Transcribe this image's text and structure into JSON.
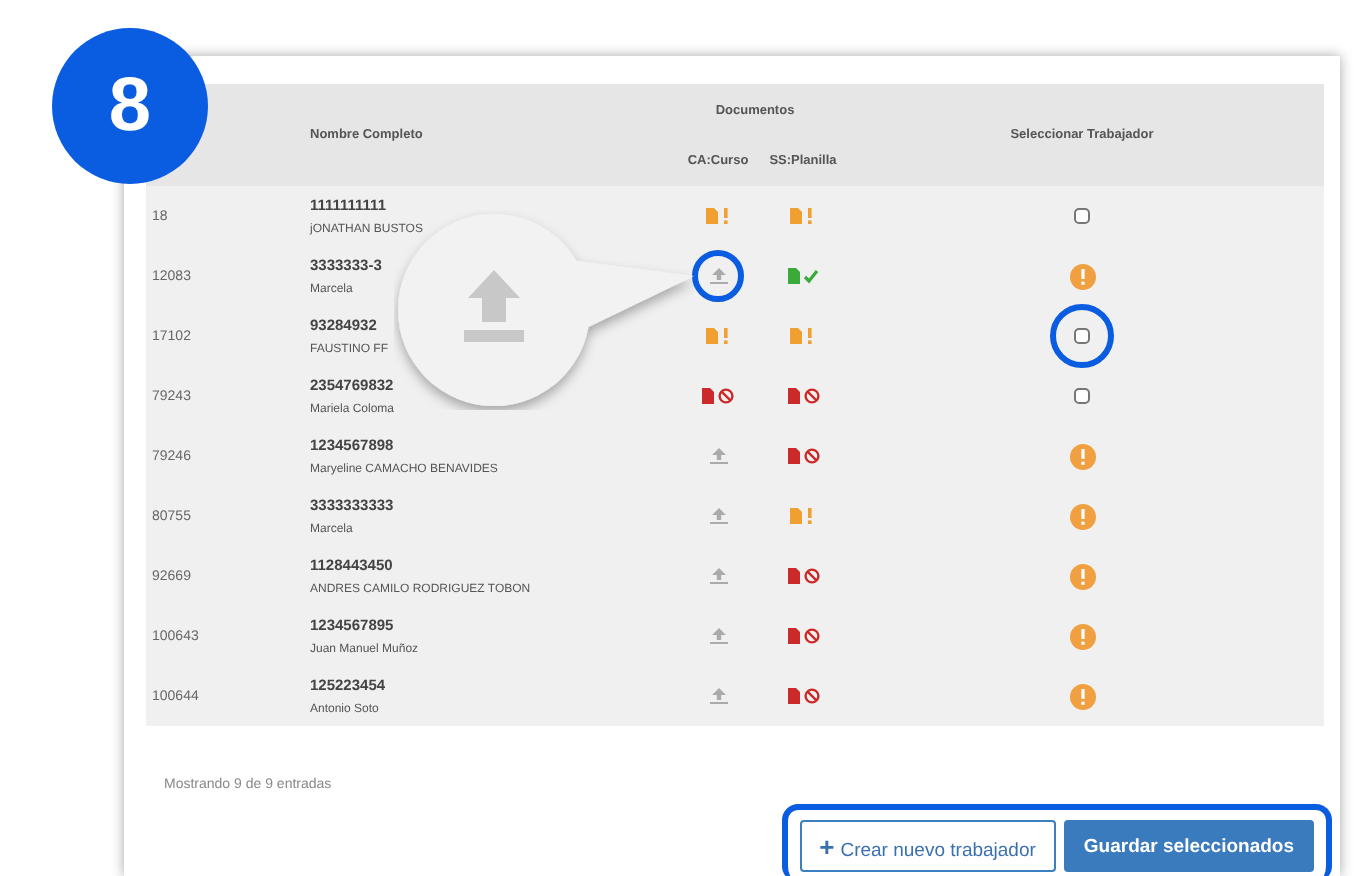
{
  "step_badge": "8",
  "table": {
    "columns": {
      "name": "Nombre Completo",
      "documents": "Documentos",
      "ca": "CA:Curso",
      "ss": "SS:Planilla",
      "select": "Seleccionar Trabajador"
    },
    "rows": [
      {
        "id": "18",
        "code": "1111111111",
        "name": "jONATHAN BUSTOS",
        "ca": {
          "kind": "pending"
        },
        "ss": {
          "kind": "pending"
        },
        "select": {
          "kind": "checkbox",
          "checked": false
        }
      },
      {
        "id": "12083",
        "code": "3333333-3",
        "name": "Marcela",
        "ca": {
          "kind": "upload",
          "highlighted": true,
          "callout": true
        },
        "ss": {
          "kind": "ok"
        },
        "select": {
          "kind": "warning"
        }
      },
      {
        "id": "17102",
        "code": "93284932",
        "name": "FAUSTINO FF",
        "ca": {
          "kind": "pending"
        },
        "ss": {
          "kind": "pending"
        },
        "select": {
          "kind": "checkbox",
          "checked": false,
          "highlighted": true
        }
      },
      {
        "id": "79243",
        "code": "2354769832",
        "name": "Mariela Coloma",
        "ca": {
          "kind": "rejected"
        },
        "ss": {
          "kind": "rejected"
        },
        "select": {
          "kind": "checkbox",
          "checked": false
        }
      },
      {
        "id": "79246",
        "code": "1234567898",
        "name": "Maryeline CAMACHO BENAVIDES",
        "ca": {
          "kind": "upload"
        },
        "ss": {
          "kind": "rejected"
        },
        "select": {
          "kind": "warning"
        }
      },
      {
        "id": "80755",
        "code": "3333333333",
        "name": "Marcela",
        "ca": {
          "kind": "upload"
        },
        "ss": {
          "kind": "pending"
        },
        "select": {
          "kind": "warning"
        }
      },
      {
        "id": "92669",
        "code": "1128443450",
        "name": "ANDRES CAMILO RODRIGUEZ TOBON",
        "ca": {
          "kind": "upload"
        },
        "ss": {
          "kind": "rejected"
        },
        "select": {
          "kind": "warning"
        }
      },
      {
        "id": "100643",
        "code": "1234567895",
        "name": "Juan Manuel Muñoz",
        "ca": {
          "kind": "upload"
        },
        "ss": {
          "kind": "rejected"
        },
        "select": {
          "kind": "warning"
        }
      },
      {
        "id": "100644",
        "code": "125223454",
        "name": "Antonio Soto",
        "ca": {
          "kind": "upload"
        },
        "ss": {
          "kind": "rejected"
        },
        "select": {
          "kind": "warning"
        }
      }
    ]
  },
  "footer": {
    "info": "Mostrando 9 de 9 entradas",
    "highlighted": true,
    "buttons": [
      {
        "kind": "secondary",
        "icon": "+",
        "label": "Crear nuevo trabajador"
      },
      {
        "kind": "primary",
        "label": "Guardar seleccionados"
      }
    ]
  }
}
